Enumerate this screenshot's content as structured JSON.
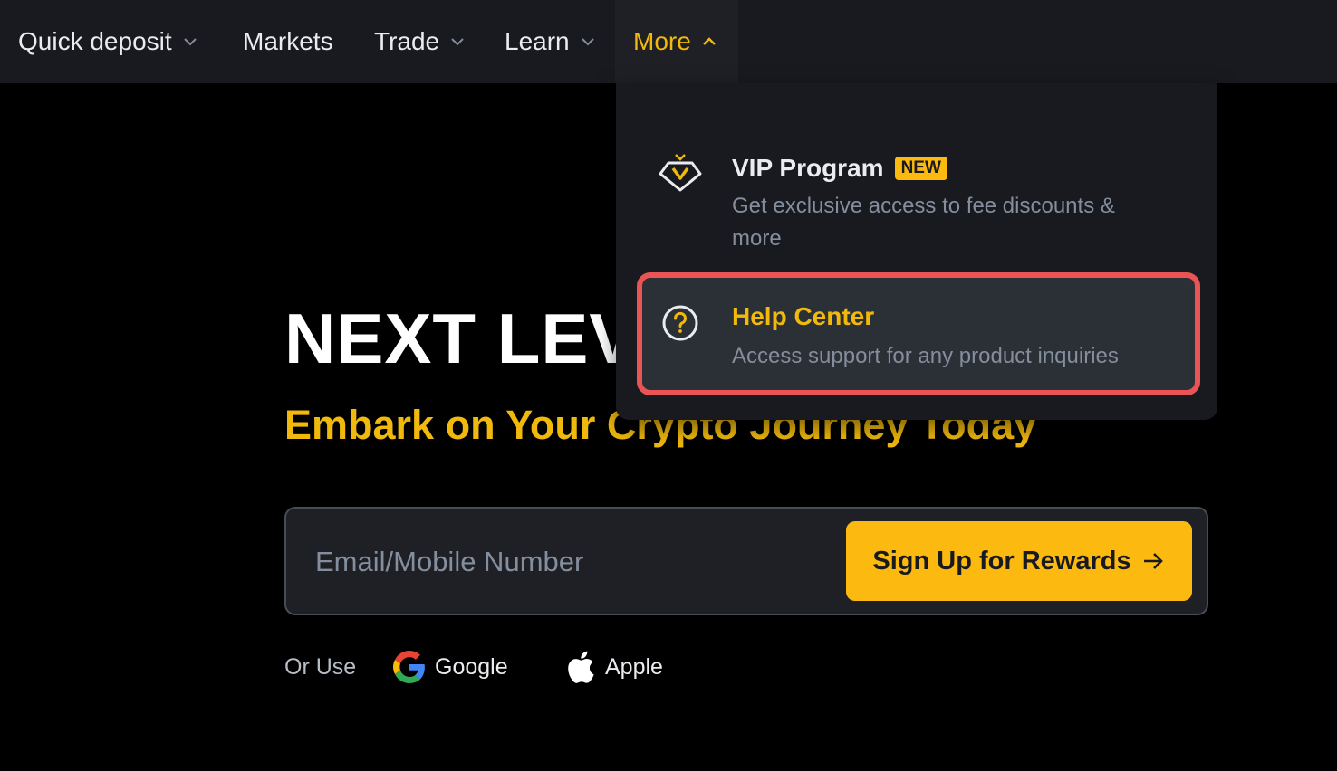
{
  "nav": {
    "items": [
      {
        "label": "Quick deposit",
        "has_dropdown": true
      },
      {
        "label": "Markets",
        "has_dropdown": false
      },
      {
        "label": "Trade",
        "has_dropdown": true
      },
      {
        "label": "Learn",
        "has_dropdown": true
      },
      {
        "label": "More",
        "has_dropdown": true,
        "active": true
      }
    ]
  },
  "dropdown": {
    "vip": {
      "title": "VIP Program",
      "badge": "NEW",
      "description": "Get exclusive access to fee discounts & more",
      "icon": "vip-diamond-icon"
    },
    "help": {
      "title": "Help Center",
      "description": "Access support for any product inquiries",
      "icon": "question-circle-icon"
    }
  },
  "hero": {
    "title": "NEXT LEV",
    "subtitle": "Embark on Your Crypto Journey Today"
  },
  "signup": {
    "placeholder": "Email/Mobile Number",
    "button_label": "Sign Up for Rewards",
    "or_use": "Or Use",
    "google_label": "Google",
    "apple_label": "Apple"
  },
  "colors": {
    "accent": "#f0b90b",
    "button": "#fcb90f",
    "nav_bg": "#181a20",
    "highlight_outline": "#ea5455"
  }
}
